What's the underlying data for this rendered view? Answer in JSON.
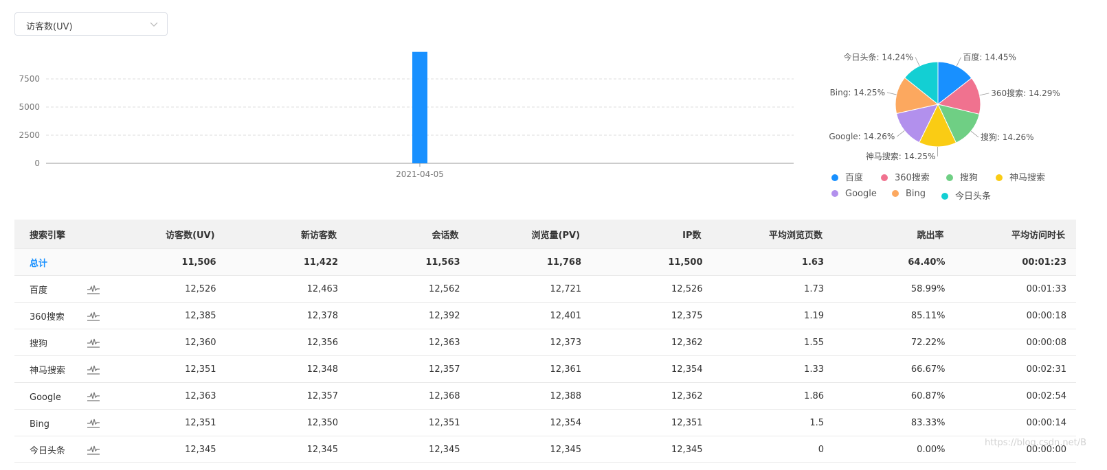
{
  "metric_select": {
    "value": "访客数(UV)"
  },
  "chart_data": [
    {
      "type": "bar",
      "categories": [
        "2021-04-05"
      ],
      "values": [
        9900
      ],
      "ylim": [
        0,
        10000
      ],
      "yticks": [
        0,
        2500,
        5000,
        7500
      ],
      "grid": true,
      "color": "#1890ff"
    },
    {
      "type": "pie",
      "slices": [
        {
          "label": "百度",
          "value": 14.45,
          "text": "百度: 14.45%",
          "color": "#1890ff"
        },
        {
          "label": "360搜索",
          "value": 14.29,
          "text": "360搜索: 14.29%",
          "color": "#f0728f"
        },
        {
          "label": "搜狗",
          "value": 14.26,
          "text": "搜狗: 14.26%",
          "color": "#6fcf84"
        },
        {
          "label": "神马搜索",
          "value": 14.25,
          "text": "神马搜索: 14.25%",
          "color": "#facc14"
        },
        {
          "label": "Google",
          "value": 14.26,
          "text": "Google: 14.26%",
          "color": "#b290ed"
        },
        {
          "label": "Bing",
          "value": 14.25,
          "text": "Bing: 14.25%",
          "color": "#fca85f"
        },
        {
          "label": "今日头条",
          "value": 14.24,
          "text": "今日头条: 14.24%",
          "color": "#13cfd3"
        }
      ],
      "legend_position": "bottom"
    }
  ],
  "table": {
    "headers": [
      "搜索引擎",
      "访客数(UV)",
      "新访客数",
      "会话数",
      "浏览量(PV)",
      "IP数",
      "平均浏览页数",
      "跳出率",
      "平均访问时长"
    ],
    "total": [
      "总计",
      "11,506",
      "11,422",
      "11,563",
      "11,768",
      "11,500",
      "1.63",
      "64.40%",
      "00:01:23"
    ],
    "rows": [
      [
        "百度",
        "12,526",
        "12,463",
        "12,562",
        "12,721",
        "12,526",
        "1.73",
        "58.99%",
        "00:01:33"
      ],
      [
        "360搜索",
        "12,385",
        "12,378",
        "12,392",
        "12,401",
        "12,375",
        "1.19",
        "85.11%",
        "00:00:18"
      ],
      [
        "搜狗",
        "12,360",
        "12,356",
        "12,363",
        "12,373",
        "12,362",
        "1.55",
        "72.22%",
        "00:00:08"
      ],
      [
        "神马搜索",
        "12,351",
        "12,348",
        "12,357",
        "12,361",
        "12,354",
        "1.33",
        "66.67%",
        "00:02:31"
      ],
      [
        "Google",
        "12,363",
        "12,357",
        "12,368",
        "12,388",
        "12,362",
        "1.86",
        "60.87%",
        "00:02:54"
      ],
      [
        "Bing",
        "12,351",
        "12,350",
        "12,351",
        "12,354",
        "12,351",
        "1.5",
        "83.33%",
        "00:00:14"
      ],
      [
        "今日头条",
        "12,345",
        "12,345",
        "12,345",
        "12,345",
        "12,345",
        "0",
        "0.00%",
        "00:00:00"
      ]
    ]
  },
  "watermark": "https://blog.csdn.net/B"
}
